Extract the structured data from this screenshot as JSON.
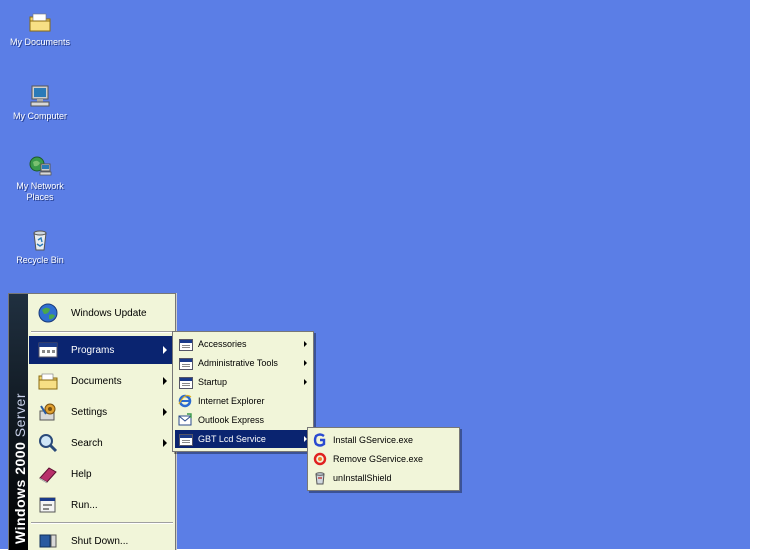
{
  "desktop": {
    "background": "#5b7ee6",
    "icons": [
      {
        "label": "My Documents",
        "icon": "folder-documents-icon"
      },
      {
        "label": "My Computer",
        "icon": "computer-icon"
      },
      {
        "label": "My Network",
        "label2": "Places",
        "icon": "network-icon"
      },
      {
        "label": "Recycle Bin",
        "icon": "recycle-bin-icon"
      }
    ]
  },
  "start_menu": {
    "banner_bold": "Windows 2000",
    "banner_light": "Server",
    "items": [
      {
        "label": "Windows Update",
        "icon": "windows-update-icon"
      },
      {
        "label": "Programs",
        "icon": "programs-icon",
        "submenu": true,
        "highlighted": true
      },
      {
        "label": "Documents",
        "icon": "documents-icon",
        "submenu": true
      },
      {
        "label": "Settings",
        "icon": "settings-icon",
        "submenu": true
      },
      {
        "label": "Search",
        "icon": "search-icon",
        "submenu": true
      },
      {
        "label": "Help",
        "icon": "help-icon"
      },
      {
        "label": "Run...",
        "icon": "run-icon"
      },
      {
        "label": "Shut Down...",
        "icon": "shutdown-icon"
      }
    ]
  },
  "programs_menu": {
    "items": [
      {
        "label": "Accessories",
        "submenu": true
      },
      {
        "label": "Administrative Tools",
        "submenu": true
      },
      {
        "label": "Startup",
        "submenu": true
      },
      {
        "label": "Internet Explorer"
      },
      {
        "label": "Outlook Express"
      },
      {
        "label": "GBT Lcd Service",
        "submenu": true,
        "highlighted": true
      }
    ]
  },
  "gbt_menu": {
    "items": [
      {
        "label": "Install GService.exe",
        "icon": "g-install-icon"
      },
      {
        "label": "Remove GService.exe",
        "icon": "remove-icon"
      },
      {
        "label": "unInstallShield",
        "icon": "uninstall-icon"
      }
    ]
  },
  "colors": {
    "highlight": "#0a2470",
    "menu_bg": "#f1f5d9"
  }
}
